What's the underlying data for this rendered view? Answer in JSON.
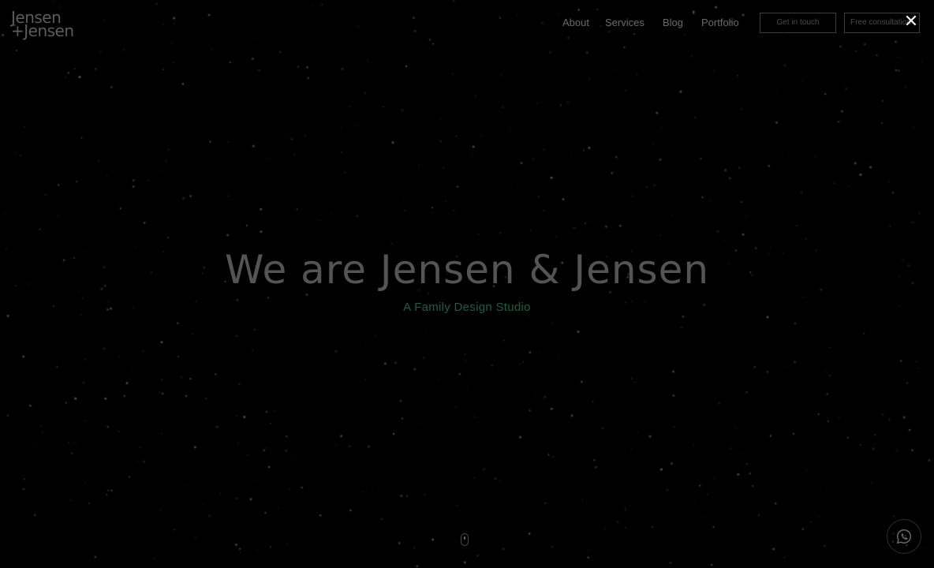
{
  "logo": {
    "line1": "Jensen",
    "line2": "+Jensen"
  },
  "nav": {
    "about": "About",
    "services": "Services",
    "blog": "Blog",
    "portfolio": "Portfolio"
  },
  "buttons": {
    "contact": "Get in touch",
    "consultation": "Free consultation"
  },
  "close_icon": "close-icon",
  "hero": {
    "title": "We are Jensen & Jensen",
    "subtitle": "A Family Design Studio"
  },
  "icons": {
    "scroll": "mouse-scroll-icon",
    "chat": "whatsapp-icon"
  },
  "colors": {
    "background": "#000000",
    "accent": "#1f5c45",
    "text": "#545454"
  }
}
